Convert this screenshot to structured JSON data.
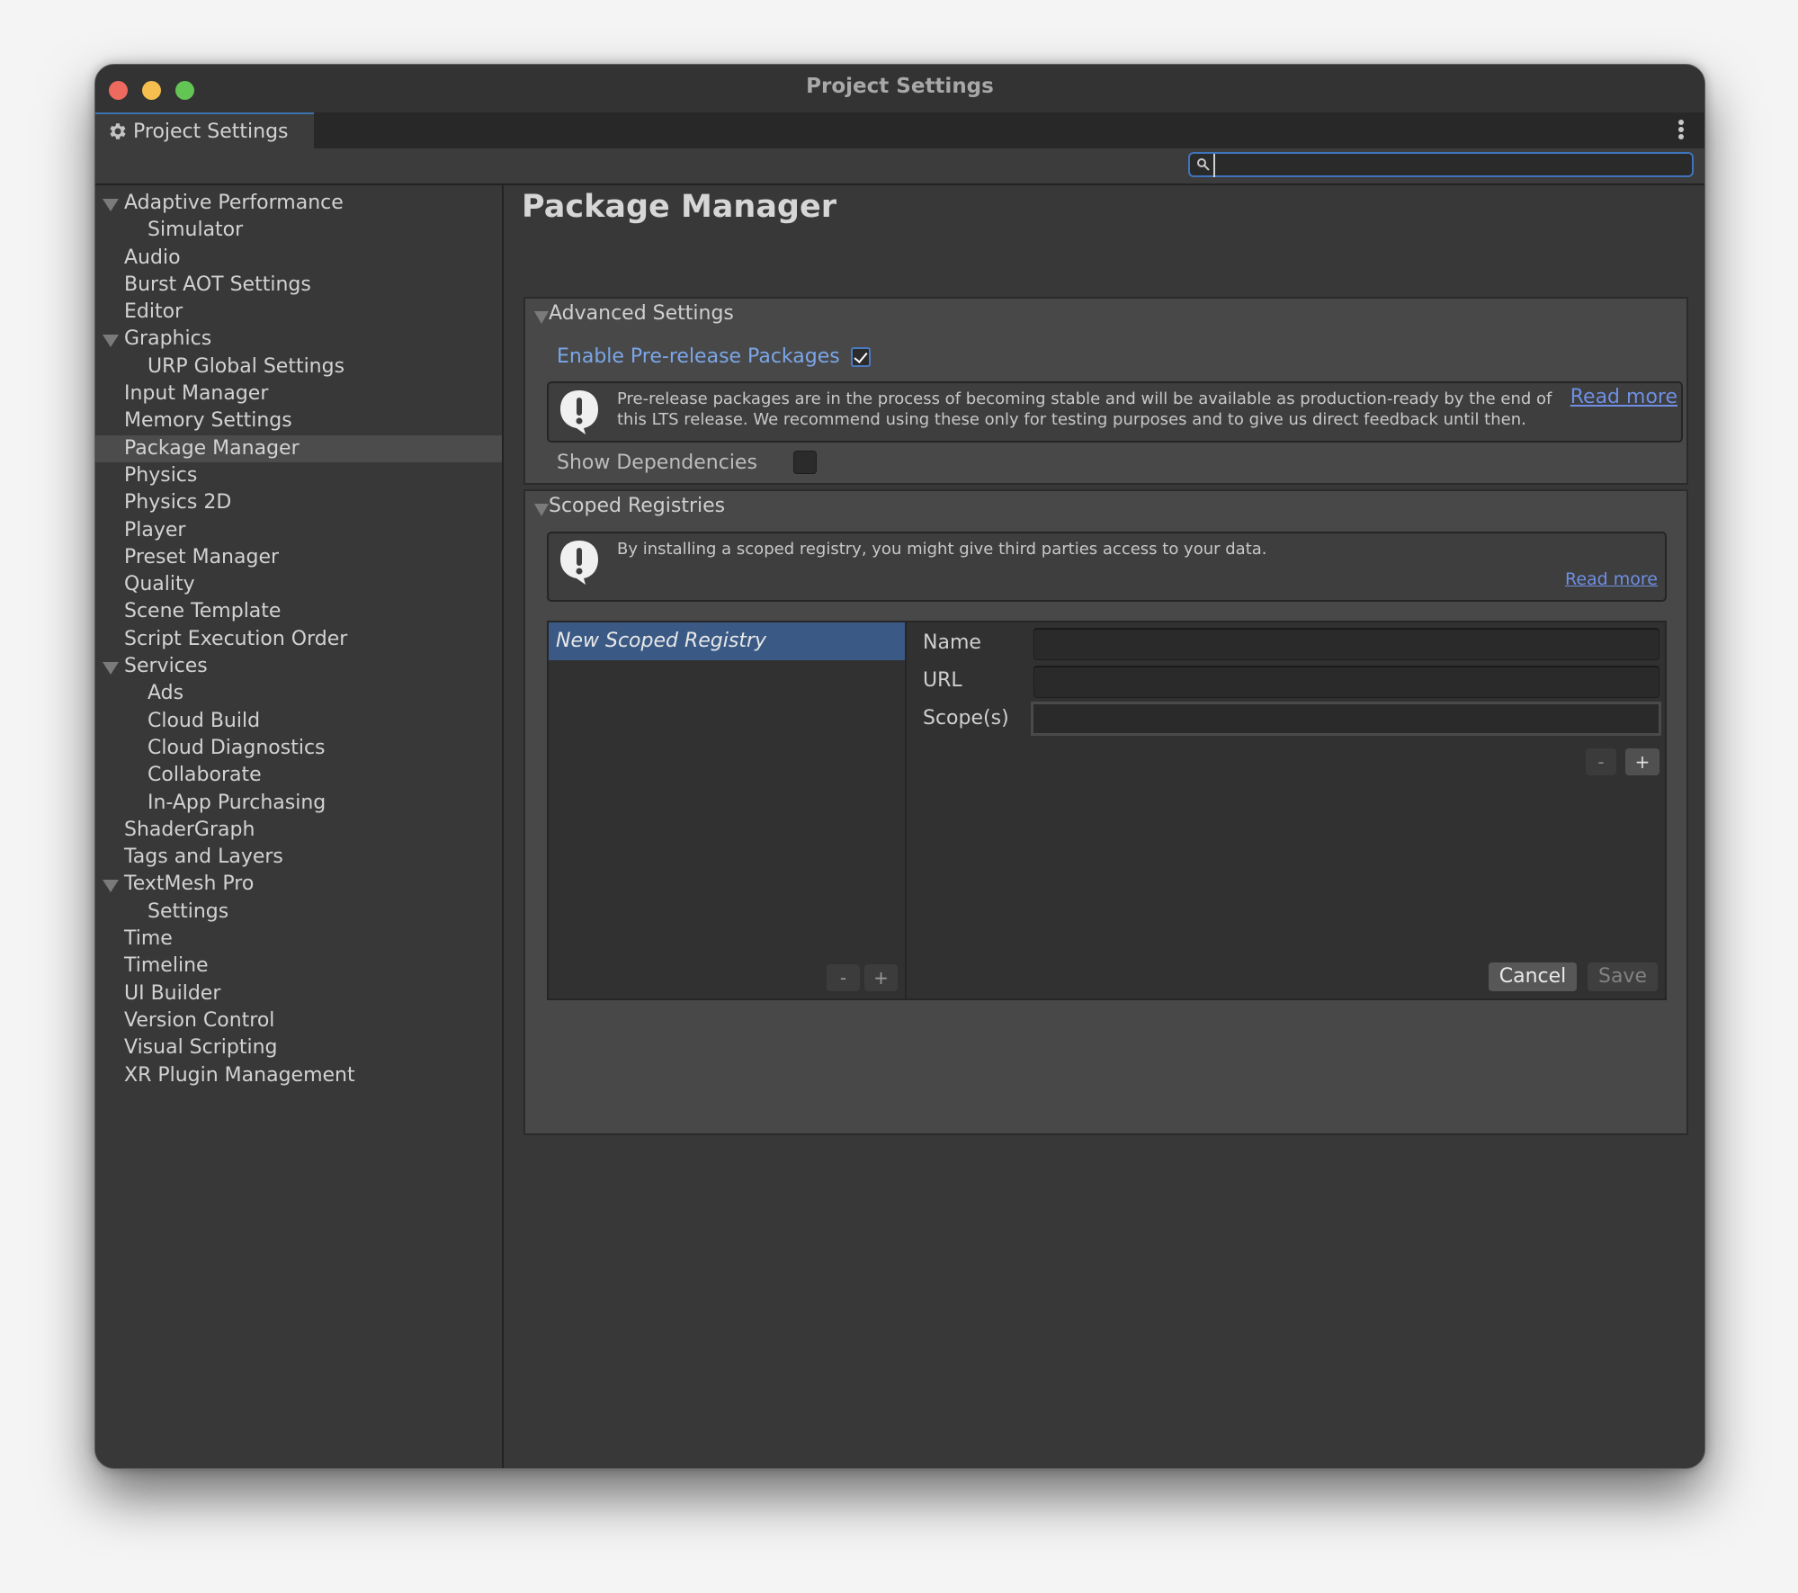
{
  "window": {
    "title": "Project Settings",
    "tab_label": "Project Settings",
    "tab_icon": "gear-icon",
    "menu_icon": "kebab-menu-icon"
  },
  "search": {
    "placeholder": "",
    "value": "",
    "icon": "search-icon"
  },
  "sidebar": {
    "selected": "Package Manager",
    "items": [
      {
        "label": "Adaptive Performance",
        "level": 0,
        "expanded": true
      },
      {
        "label": "Simulator",
        "level": 1
      },
      {
        "label": "Audio",
        "level": 0
      },
      {
        "label": "Burst AOT Settings",
        "level": 0
      },
      {
        "label": "Editor",
        "level": 0
      },
      {
        "label": "Graphics",
        "level": 0,
        "expanded": true
      },
      {
        "label": "URP Global Settings",
        "level": 1
      },
      {
        "label": "Input Manager",
        "level": 0
      },
      {
        "label": "Memory Settings",
        "level": 0
      },
      {
        "label": "Package Manager",
        "level": 0,
        "selected": true
      },
      {
        "label": "Physics",
        "level": 0
      },
      {
        "label": "Physics 2D",
        "level": 0
      },
      {
        "label": "Player",
        "level": 0
      },
      {
        "label": "Preset Manager",
        "level": 0
      },
      {
        "label": "Quality",
        "level": 0
      },
      {
        "label": "Scene Template",
        "level": 0
      },
      {
        "label": "Script Execution Order",
        "level": 0
      },
      {
        "label": "Services",
        "level": 0,
        "expanded": true
      },
      {
        "label": "Ads",
        "level": 1
      },
      {
        "label": "Cloud Build",
        "level": 1
      },
      {
        "label": "Cloud Diagnostics",
        "level": 1
      },
      {
        "label": "Collaborate",
        "level": 1
      },
      {
        "label": "In-App Purchasing",
        "level": 1
      },
      {
        "label": "ShaderGraph",
        "level": 0
      },
      {
        "label": "Tags and Layers",
        "level": 0
      },
      {
        "label": "TextMesh Pro",
        "level": 0,
        "expanded": true
      },
      {
        "label": "Settings",
        "level": 1
      },
      {
        "label": "Time",
        "level": 0
      },
      {
        "label": "Timeline",
        "level": 0
      },
      {
        "label": "UI Builder",
        "level": 0
      },
      {
        "label": "Version Control",
        "level": 0
      },
      {
        "label": "Visual Scripting",
        "level": 0
      },
      {
        "label": "XR Plugin Management",
        "level": 0
      }
    ]
  },
  "main": {
    "title": "Package Manager",
    "advanced": {
      "header": "Advanced Settings",
      "prerelease_label": "Enable Pre-release Packages",
      "prerelease_checked": true,
      "info_text": "Pre-release packages are in the process of becoming stable and will be available as production-ready by the end of this LTS release. We recommend using these only for testing purposes and to give us direct feedback until then.",
      "read_more": "Read more",
      "show_dependencies_label": "Show Dependencies",
      "show_dependencies_checked": false
    },
    "scoped": {
      "header": "Scoped Registries",
      "info_text": "By installing a scoped registry, you might give third parties access to your data.",
      "read_more": "Read more",
      "registries": [
        "New Scoped Registry"
      ],
      "list_minus": "-",
      "list_plus": "+",
      "form": {
        "name_label": "Name",
        "name_value": "",
        "url_label": "URL",
        "url_value": "",
        "scopes_label": "Scope(s)",
        "scopes_value": "",
        "scope_minus": "-",
        "scope_plus": "+",
        "cancel": "Cancel",
        "save": "Save"
      }
    }
  },
  "colors": {
    "accent": "#3a5a85",
    "link": "#6e8fe3",
    "focus": "#3f74bd"
  }
}
